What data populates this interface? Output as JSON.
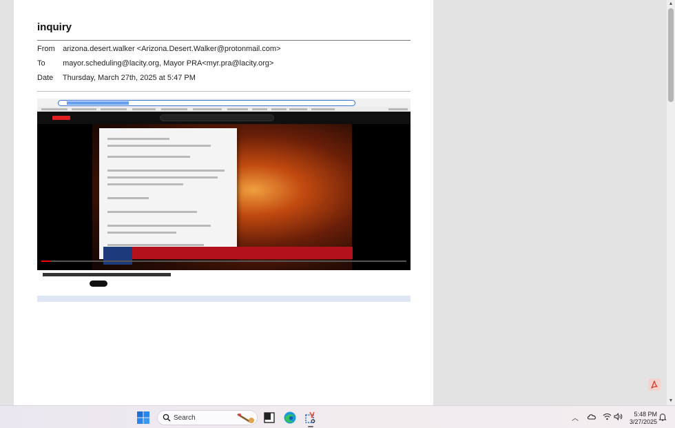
{
  "document": {
    "title": "inquiry",
    "from_label": "From",
    "from_value": "arizona.desert.walker <Arizona.Desert.Walker@protonmail.com>",
    "to_label": "To",
    "to_value": "mayor.scheduling@lacity.org, Mayor PRA<myr.pra@lacity.org>",
    "date_label": "Date",
    "date_value": "Thursday, March 27th, 2025 at 5:47 PM"
  },
  "embedded_screenshot": {
    "subject": "Karen Bass' text messages on Palisades Fire released after being deleted"
  },
  "taskbar": {
    "search_label": "Search",
    "time": "5:48 PM",
    "date": "3/27/2025"
  },
  "colors": {
    "taskbar_bg": "#ece8f0",
    "windows_blue": "#1f6fd6",
    "pdf_red": "#d43a2a",
    "breaking_red": "#b3121d"
  },
  "icons": {
    "start": "windows-start-icon",
    "search": "search-icon",
    "task_view": "task-view-icon",
    "edge": "edge-browser-icon",
    "snipping": "snipping-tool-icon",
    "chevron": "chevron-up-icon",
    "cloud": "onedrive-cloud-icon",
    "wifi": "wifi-icon",
    "volume": "volume-icon",
    "bell": "notification-bell-icon",
    "pdf": "pdf-icon"
  }
}
